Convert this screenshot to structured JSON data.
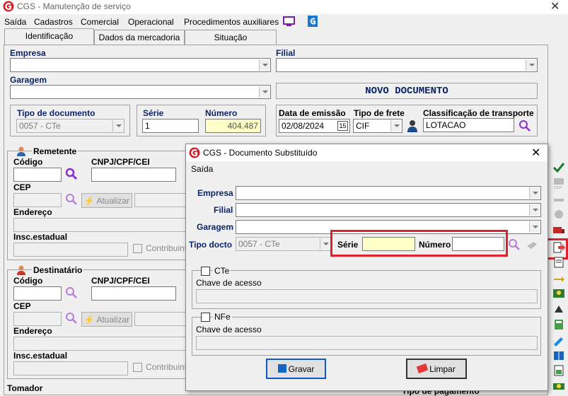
{
  "window": {
    "title": "CGS - Manutenção de serviço"
  },
  "menu": [
    "Saída",
    "Cadastros",
    "Comercial",
    "Operacional",
    "Procedimentos auxiliares"
  ],
  "tabs": [
    "Identificação",
    "Dados da mercadoria",
    "Situação"
  ],
  "form": {
    "empresa_label": "Empresa",
    "filial_label": "Filial",
    "garagem_label": "Garagem",
    "novo_documento": "NOVO DOCUMENTO",
    "tipo_documento_label": "Tipo de documento",
    "tipo_documento_value": "0057 - CTe",
    "serie_label": "Série",
    "serie_value": "1",
    "numero_label": "Número",
    "numero_value": "404.487",
    "data_emissao_label": "Data de emissão",
    "data_emissao_value": "02/08/2024",
    "tipo_frete_label": "Tipo de frete",
    "tipo_frete_value": "CIF",
    "classificacao_label": "Classificação de transporte",
    "classificacao_value": "LOTACAO"
  },
  "remetente": {
    "title": "Remetente",
    "codigo_label": "Código",
    "cnpj_label": "CNPJ/CPF/CEI",
    "cep_label": "CEP",
    "atualizar": "Atualizar",
    "endereco_label": "Endereço",
    "insc_label": "Insc.estadual",
    "contribuinte": "Contribuinte"
  },
  "destinatario": {
    "title": "Destinatário",
    "codigo_label": "Código",
    "cnpj_label": "CNPJ/CPF/CEI",
    "cep_label": "CEP",
    "atualizar": "Atualizar",
    "endereco_label": "Endereço",
    "insc_label": "Insc.estadual",
    "contribuinte": "Contribuinte"
  },
  "bottom": {
    "tomador": "Tomador",
    "tipo_pagamento": "Tipo de pagamento"
  },
  "dialog": {
    "title": "CGS - Documento Substituído",
    "menu": "Saída",
    "empresa_label": "Empresa",
    "filial_label": "Filial",
    "garagem_label": "Garagem",
    "tipo_docto_label": "Tipo docto",
    "tipo_docto_value": "0057 - CTe",
    "serie_label": "Série",
    "numero_label": "Número",
    "cte_label": "CTe",
    "cte_chave_label": "Chave de acesso",
    "nfe_label": "NFe",
    "nfe_chave_label": "Chave de acesso",
    "gravar": "Gravar",
    "limpar": "Limpar"
  },
  "colors": {
    "accent_blue": "#0a246a",
    "highlight_red": "#e0202a",
    "yellow_field": "#ffffc8"
  }
}
